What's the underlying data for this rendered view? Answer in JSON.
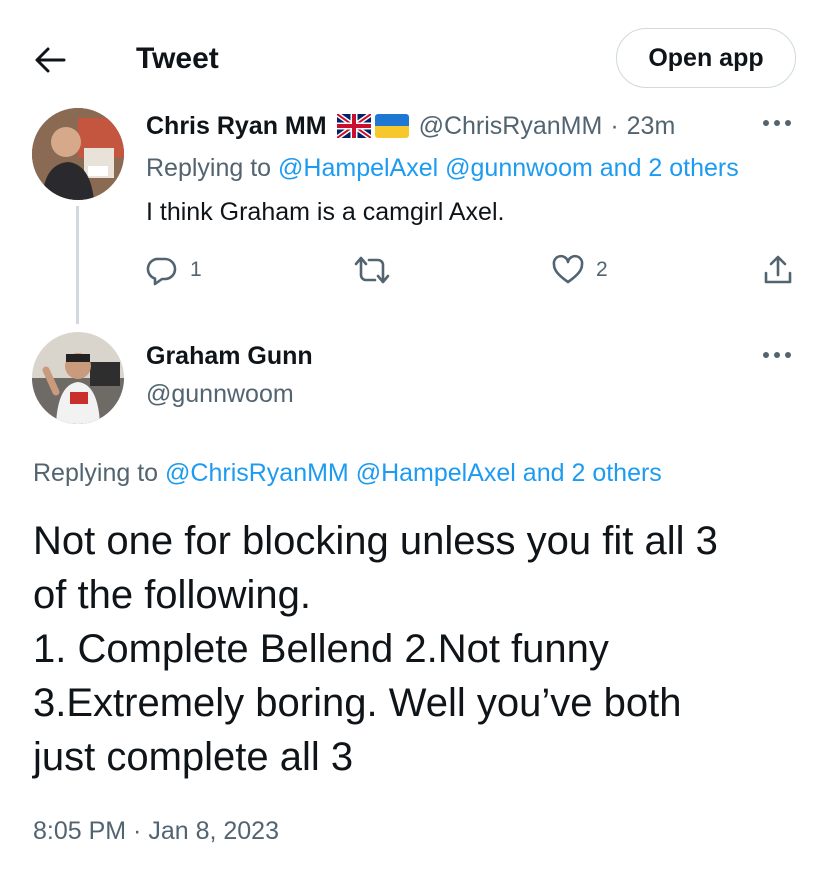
{
  "header": {
    "back_icon": "arrow-left-icon",
    "title": "Tweet",
    "open_app_label": "Open app"
  },
  "parent_tweet": {
    "author_name": "Chris Ryan MM",
    "flags": [
      "uk-flag-icon",
      "ukraine-flag-icon"
    ],
    "handle": "@ChrisRyanMM",
    "separator": "·",
    "time": "23m",
    "more_icon": "more-dots-icon",
    "replying_prefix": "Replying to",
    "replying_to": "@HampelAxel @gunnwoom and 2 others",
    "text": "I think Graham is a camgirl Axel.",
    "actions": {
      "reply_count": "1",
      "retweet_count": "",
      "like_count": "2"
    }
  },
  "main_tweet": {
    "author_name": "Graham Gunn",
    "handle": "@gunnwoom",
    "more_icon": "more-dots-icon",
    "replying_prefix": "Replying to",
    "replying_to": "@ChrisRyanMM @HampelAxel and 2 others",
    "text_lines": [
      "Not one for blocking unless you fit all 3",
      "of the following.",
      "1. Complete Bellend 2.Not funny",
      "3.Extremely boring. Well you’ve both",
      "just complete all 3"
    ],
    "timestamp": "8:05 PM · Jan 8, 2023"
  },
  "colors": {
    "link": "#1d9bf0",
    "secondary_text": "#536471",
    "primary_text": "#0f1419",
    "border": "#cfd9de"
  }
}
